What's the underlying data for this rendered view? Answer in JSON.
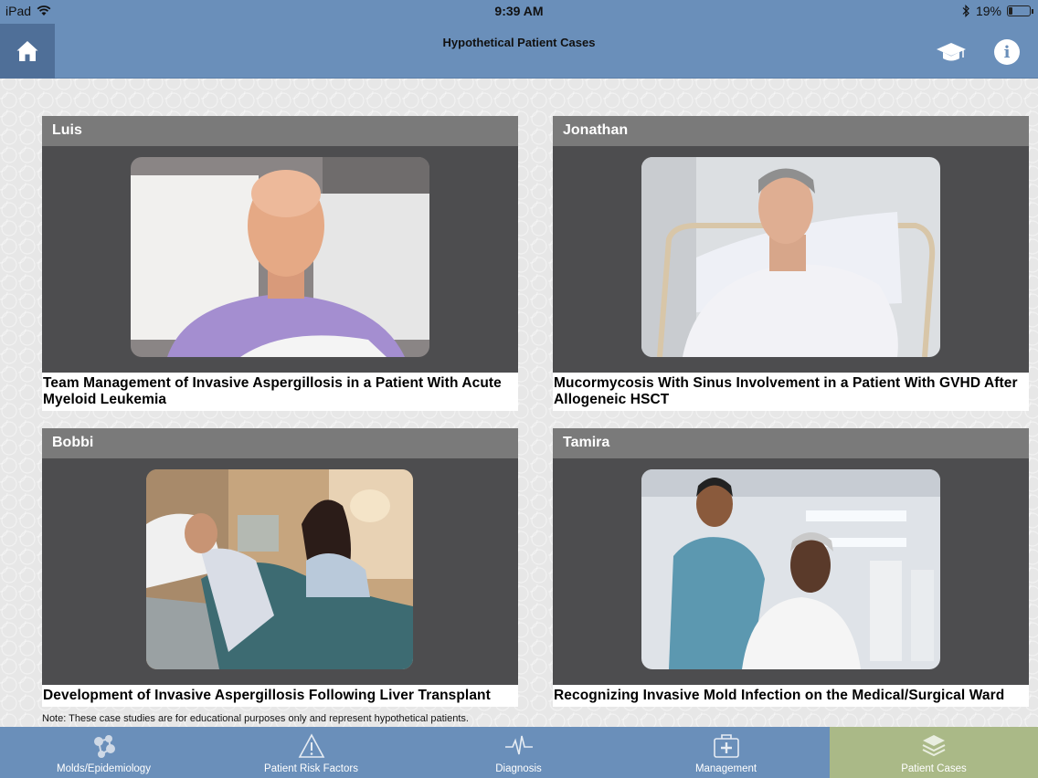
{
  "status_bar": {
    "device": "iPad",
    "time": "9:39 AM",
    "battery": "19%",
    "battery_level": 0.19
  },
  "nav": {
    "title": "Hypothetical Patient Cases",
    "home_icon": "home-icon",
    "education_icon": "graduation-cap-icon",
    "info_icon": "info-icon",
    "info_glyph": "i"
  },
  "cases": [
    {
      "name": "Luis",
      "title": "Team Management of Invasive Aspergillosis in a Patient With Acute Myeloid Leukemia"
    },
    {
      "name": "Jonathan",
      "title": "Mucormycosis With Sinus Involvement in a Patient With GVHD After Allogeneic HSCT"
    },
    {
      "name": "Bobbi",
      "title": "Development of Invasive Aspergillosis Following Liver Transplant"
    },
    {
      "name": "Tamira",
      "title": "Recognizing Invasive Mold Infection on the Medical/Surgical Ward"
    }
  ],
  "note": "Note: These case studies are for educational purposes only and represent hypothetical patients.",
  "tabs": [
    {
      "label": "Molds/Epidemiology",
      "icon": "molecule-icon"
    },
    {
      "label": "Patient Risk Factors",
      "icon": "warning-icon"
    },
    {
      "label": "Diagnosis",
      "icon": "pulse-icon"
    },
    {
      "label": "Management",
      "icon": "medical-kit-icon"
    },
    {
      "label": "Patient Cases",
      "icon": "layers-icon",
      "active": true
    }
  ],
  "colors": {
    "bar_blue": "#6a8fba",
    "active_tab": "#aab987",
    "card_header": "#7a7a7a",
    "card_body": "#4d4d4f"
  }
}
